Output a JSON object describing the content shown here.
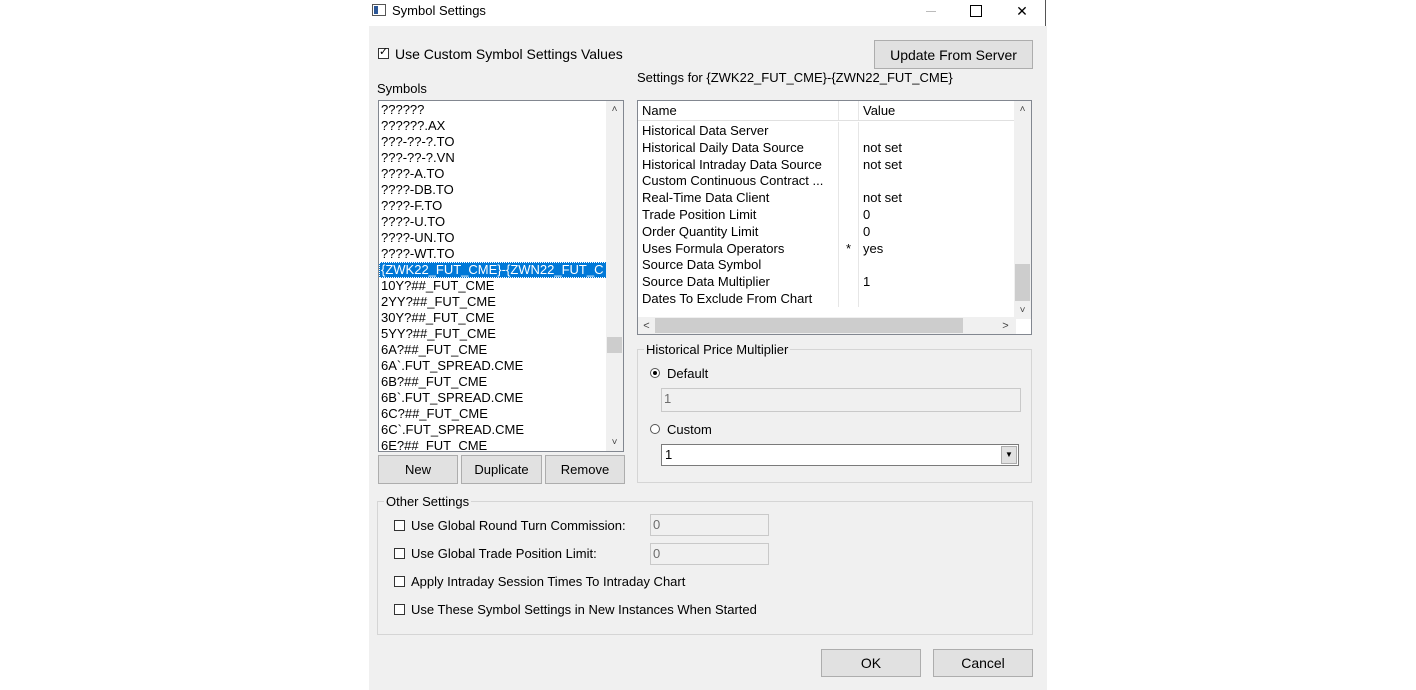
{
  "window": {
    "title": "Symbol Settings",
    "minimize": "—",
    "maximize": "",
    "close": "✕"
  },
  "top": {
    "use_custom_label": "Use Custom Symbol Settings Values",
    "use_custom_checked": true,
    "update_button": "Update From Server"
  },
  "symbols": {
    "label": "Symbols",
    "items": [
      "??????",
      "??????.AX",
      "???-??-?.TO",
      "???-??-?.VN",
      "????-A.TO",
      "????-DB.TO",
      "????-F.TO",
      "????-U.TO",
      "????-UN.TO",
      "????-WT.TO",
      "{ZWK22_FUT_CME}-{ZWN22_FUT_C",
      "10Y?##_FUT_CME",
      "2YY?##_FUT_CME",
      "30Y?##_FUT_CME",
      "5YY?##_FUT_CME",
      "6A?##_FUT_CME",
      "6A`.FUT_SPREAD.CME",
      "6B?##_FUT_CME",
      "6B`.FUT_SPREAD.CME",
      "6C?##_FUT_CME",
      "6C`.FUT_SPREAD.CME",
      "6E?##_FUT_CME"
    ],
    "selected_index": 10,
    "new_button": "New",
    "duplicate_button": "Duplicate",
    "remove_button": "Remove",
    "scroll_up": "˄",
    "scroll_down": "˅"
  },
  "settings": {
    "label": "Settings for {ZWK22_FUT_CME}-{ZWN22_FUT_CME}",
    "columns": {
      "name": "Name",
      "value": "Value"
    },
    "rows": [
      {
        "name": "Historical Data Server",
        "flag": "",
        "value": ""
      },
      {
        "name": "Historical Daily Data Source",
        "flag": "",
        "value": "not set"
      },
      {
        "name": "Historical Intraday Data Source",
        "flag": "",
        "value": "not set"
      },
      {
        "name": "Custom Continuous Contract ...",
        "flag": "",
        "value": ""
      },
      {
        "name": "Real-Time Data Client",
        "flag": "",
        "value": "not set"
      },
      {
        "name": "Trade Position Limit",
        "flag": "",
        "value": "0"
      },
      {
        "name": "Order Quantity Limit",
        "flag": "",
        "value": "0"
      },
      {
        "name": "Uses Formula Operators",
        "flag": "*",
        "value": "yes"
      },
      {
        "name": "Source Data Symbol",
        "flag": "",
        "value": ""
      },
      {
        "name": "Source Data Multiplier",
        "flag": "",
        "value": "1"
      },
      {
        "name": "Dates To Exclude From Chart",
        "flag": "",
        "value": ""
      }
    ],
    "scroll_left": "<",
    "scroll_right": ">",
    "scroll_up": "˄",
    "scroll_down": "˅"
  },
  "multiplier": {
    "group_title": "Historical Price Multiplier",
    "default_label": "Default",
    "default_selected": true,
    "default_value": "1",
    "custom_label": "Custom",
    "custom_value": "1",
    "combo_arrow": "▼"
  },
  "other": {
    "group_title": "Other Settings",
    "round_turn_label": "Use Global Round Turn Commission:",
    "round_turn_value": "0",
    "position_limit_label": "Use Global Trade Position Limit:",
    "position_limit_value": "0",
    "session_times_label": "Apply Intraday Session Times To Intraday Chart",
    "new_instances_label": "Use These Symbol Settings in New Instances When Started"
  },
  "footer": {
    "ok_button": "OK",
    "cancel_button": "Cancel"
  }
}
